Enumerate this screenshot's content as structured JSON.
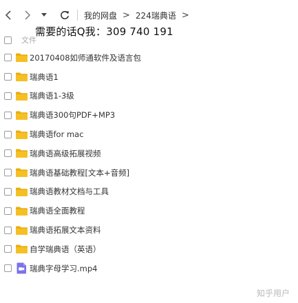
{
  "nav": {
    "back_icon": "chevron-left-icon",
    "forward_icon": "chevron-right-icon",
    "dropdown_icon": "caret-down-icon",
    "refresh_icon": "refresh-icon",
    "breadcrumbs": [
      "我的网盘",
      "224瑞典语"
    ],
    "separator": ">"
  },
  "overlay_text": "需要的话Q我：309 740 191",
  "list_header": {
    "name_label": "文件"
  },
  "files": [
    {
      "name": "20170408如师通软件及语言包",
      "type": "folder"
    },
    {
      "name": "瑞典语1",
      "type": "folder"
    },
    {
      "name": "瑞典语1-3级",
      "type": "folder"
    },
    {
      "name": "瑞典语300句PDF+MP3",
      "type": "folder"
    },
    {
      "name": "瑞典语for mac",
      "type": "folder"
    },
    {
      "name": "瑞典语高级拓展视频",
      "type": "folder"
    },
    {
      "name": "瑞典语基础教程[文本+音频]",
      "type": "folder"
    },
    {
      "name": "瑞典语教材文档与工具",
      "type": "folder"
    },
    {
      "name": "瑞典语全面教程",
      "type": "folder"
    },
    {
      "name": "瑞典语拓展文本资料",
      "type": "folder"
    },
    {
      "name": "自学瑞典语（英语）",
      "type": "folder"
    },
    {
      "name": "瑞典字母学习.mp4",
      "type": "video"
    }
  ],
  "watermark": "知乎用户",
  "colors": {
    "folder": "#F5C024",
    "folder_tab": "#E9AE12",
    "video": "#7B73E8",
    "checkbox_border": "#9A9A9A"
  }
}
